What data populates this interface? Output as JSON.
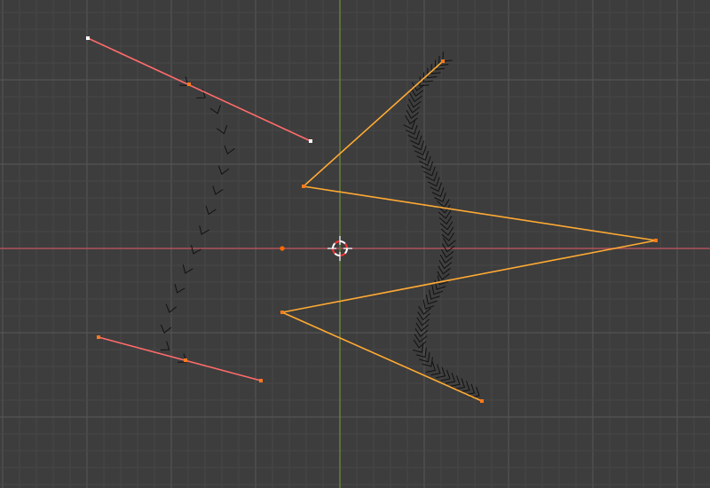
{
  "viewport": {
    "background_color": "#3d3d3d",
    "grid_minor_color": "#474747",
    "grid_major_color": "#545454",
    "x_axis_color": "#c4525c",
    "y_axis_color": "#6a8f32"
  },
  "colors": {
    "active_curve": "#ffaa33",
    "handle_line": "#ff6b6b",
    "selected_point": "#ff7a1a",
    "unselected_point": "#ffffff",
    "normal_marks": "#111111",
    "cursor": "#ffffff",
    "cursor_accent": "#ff3333",
    "origin_dot": "#ff6a00"
  },
  "icons": {
    "cursor": "3d-cursor-icon",
    "origin": "object-origin-icon"
  }
}
